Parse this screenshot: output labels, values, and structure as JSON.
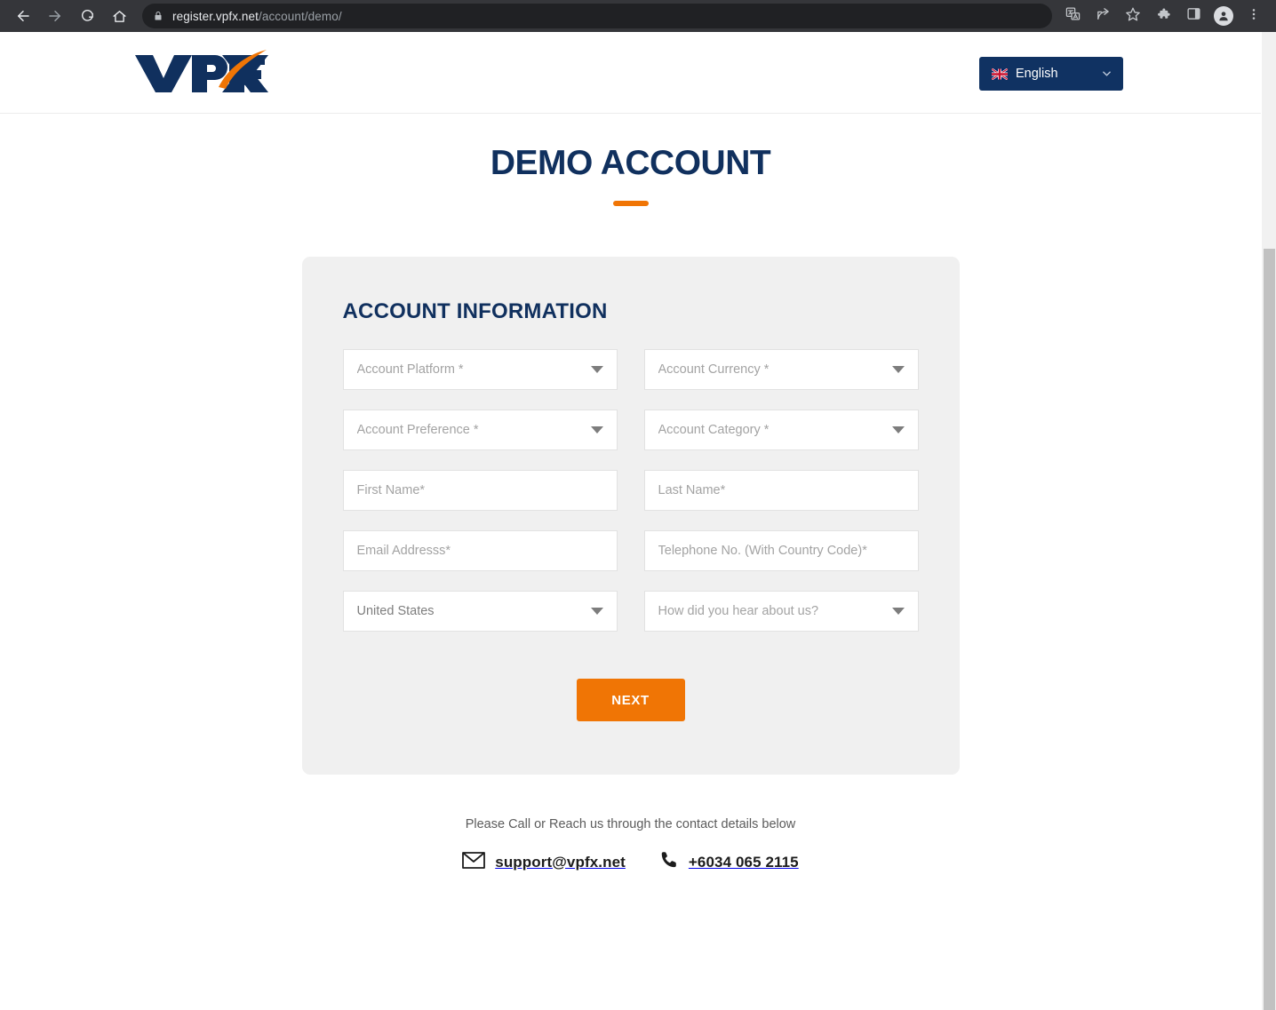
{
  "browser": {
    "back_icon": "back-arrow-icon",
    "forward_icon": "forward-arrow-icon",
    "reload_icon": "reload-icon",
    "home_icon": "home-icon",
    "lock_icon": "lock-icon",
    "url_host": "register.vpfx.net",
    "url_path": "/account/demo/",
    "translate_icon": "translate-icon",
    "share_icon": "share-icon",
    "bookmark_icon": "bookmark-star-icon",
    "extensions_icon": "extensions-puzzle-icon",
    "sidepanel_icon": "side-panel-icon",
    "profile_icon": "profile-avatar-icon",
    "menu_icon": "three-dot-menu-icon"
  },
  "header": {
    "logo_text": "VPFX",
    "language": {
      "label": "English",
      "flag": "uk-flag-icon",
      "caret": "chevron-down-icon"
    }
  },
  "page": {
    "title": "DEMO ACCOUNT"
  },
  "form": {
    "heading": "ACCOUNT INFORMATION",
    "rows": [
      [
        {
          "name": "account-platform",
          "text": "Account Platform *",
          "type": "select",
          "filled": false
        },
        {
          "name": "account-currency",
          "text": "Account Currency *",
          "type": "select",
          "filled": false
        }
      ],
      [
        {
          "name": "account-preference",
          "text": "Account Preference *",
          "type": "select",
          "filled": false
        },
        {
          "name": "account-category",
          "text": "Account Category *",
          "type": "select",
          "filled": false
        }
      ],
      [
        {
          "name": "first-name",
          "text": "First Name*",
          "type": "text",
          "filled": false
        },
        {
          "name": "last-name",
          "text": "Last Name*",
          "type": "text",
          "filled": false
        }
      ],
      [
        {
          "name": "email-address",
          "text": "Email Addresss*",
          "type": "text",
          "filled": false
        },
        {
          "name": "telephone",
          "text": "Telephone No. (With Country Code)*",
          "type": "text",
          "filled": false
        }
      ],
      [
        {
          "name": "country",
          "text": "United States",
          "type": "select",
          "filled": true
        },
        {
          "name": "referral-source",
          "text": "How did you hear about us?",
          "type": "select",
          "filled": false
        }
      ]
    ],
    "next_label": "NEXT"
  },
  "contact": {
    "lead": "Please Call or Reach us through the contact details below",
    "email_icon": "envelope-icon",
    "email": "support@vpfx.net",
    "phone_icon": "phone-icon",
    "phone": "+6034 065 2115"
  },
  "colors": {
    "brand_navy": "#10305e",
    "brand_orange": "#f07505",
    "card_bg": "#f0f0f0",
    "chrome_bg": "#35363a",
    "omnibox_bg": "#202124"
  }
}
